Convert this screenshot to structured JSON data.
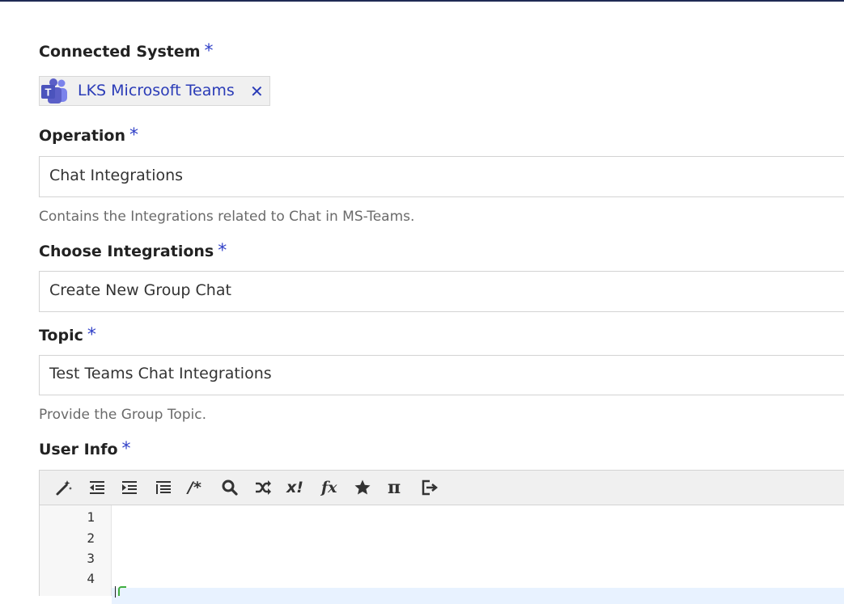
{
  "connected_system": {
    "label": "Connected System",
    "required_mark": "*",
    "chip_text": "LKS Microsoft Teams",
    "close_glyph": "✕",
    "logo_icon": "microsoft-teams-logo",
    "logo_letter": "T"
  },
  "operation": {
    "label": "Operation",
    "required_mark": "*",
    "value": "Chat Integrations",
    "help": "Contains the Integrations related to Chat in MS-Teams."
  },
  "choose_integrations": {
    "label": "Choose Integrations",
    "required_mark": "*",
    "value": "Create New Group Chat"
  },
  "topic": {
    "label": "Topic",
    "required_mark": "*",
    "value": "Test Teams Chat Integrations",
    "help": "Provide the Group Topic."
  },
  "user_info": {
    "label": "User Info",
    "required_mark": "*",
    "toolbar": {
      "comment_label": "/*",
      "test_label": "x!",
      "function_label": "fx",
      "pi_label": "π",
      "icons": [
        "magic-wand-icon",
        "outdent-icon",
        "indent-icon",
        "list-icon",
        "comment-icon",
        "search-icon",
        "shuffle-icon",
        "test-icon",
        "function-icon",
        "star-icon",
        "pi-icon",
        "exit-icon"
      ]
    },
    "line_numbers": [
      "1",
      "2",
      "3",
      "4"
    ]
  },
  "colors": {
    "accent": "#2f3fc7",
    "teams_purple": "#5b5fc7",
    "toolbar_bg": "#f0f0f0",
    "active_line": "#e8f2ff"
  }
}
